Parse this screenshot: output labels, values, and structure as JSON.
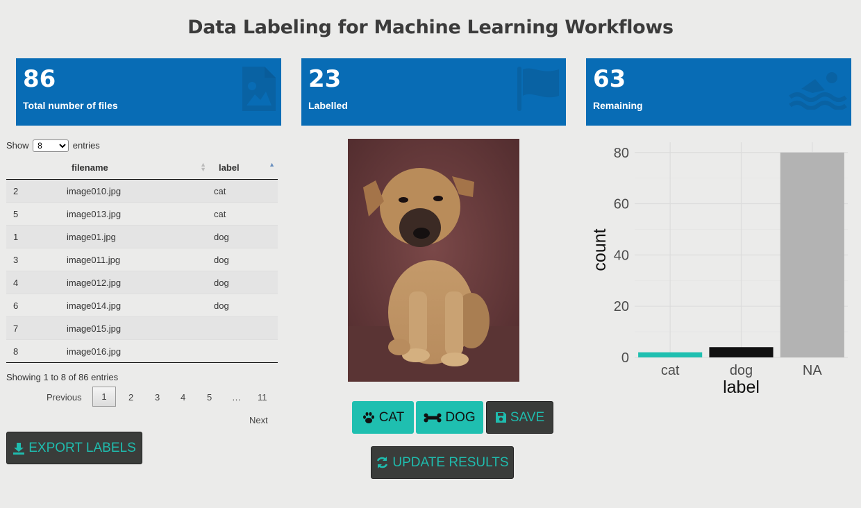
{
  "page": {
    "title": "Data Labeling for Machine Learning Workflows"
  },
  "boxes": [
    {
      "value": "86",
      "label": "Total number of files",
      "icon": "file-image-icon"
    },
    {
      "value": "23",
      "label": "Labelled",
      "icon": "flag-icon"
    },
    {
      "value": "63",
      "label": "Remaining",
      "icon": "swimmer-icon"
    }
  ],
  "table": {
    "show_label": "Show",
    "entries_label": "entries",
    "page_length": "8",
    "columns": [
      "",
      "filename",
      "label"
    ],
    "rows": [
      [
        "2",
        "image010.jpg",
        "cat"
      ],
      [
        "5",
        "image013.jpg",
        "cat"
      ],
      [
        "1",
        "image01.jpg",
        "dog"
      ],
      [
        "3",
        "image011.jpg",
        "dog"
      ],
      [
        "4",
        "image012.jpg",
        "dog"
      ],
      [
        "6",
        "image014.jpg",
        "dog"
      ],
      [
        "7",
        "image015.jpg",
        ""
      ],
      [
        "8",
        "image016.jpg",
        ""
      ]
    ],
    "info": "Showing 1 to 8 of 86 entries",
    "pager": {
      "previous": "Previous",
      "pages": [
        "1",
        "2",
        "3",
        "4",
        "5",
        "…",
        "11"
      ],
      "current": "1",
      "next": "Next"
    }
  },
  "buttons": {
    "export": "EXPORT LABELS",
    "cat": "CAT",
    "dog": "DOG",
    "save": "SAVE",
    "update": "UPDATE RESULTS"
  },
  "colors": {
    "box_blue": "#086cb5",
    "teal": "#1fbfb0",
    "dark_button": "#3a3c3a",
    "background": "#ebebea"
  },
  "chart_data": {
    "type": "bar",
    "categories": [
      "cat",
      "dog",
      "NA"
    ],
    "values": [
      2,
      4,
      80
    ],
    "bar_colors": [
      "#1fbfb0",
      "#111111",
      "#b3b3b3"
    ],
    "xlabel": "label",
    "ylabel": "count",
    "yticks": [
      "0",
      "20",
      "40",
      "60",
      "80"
    ],
    "ylim": [
      0,
      84
    ],
    "grid": true
  }
}
